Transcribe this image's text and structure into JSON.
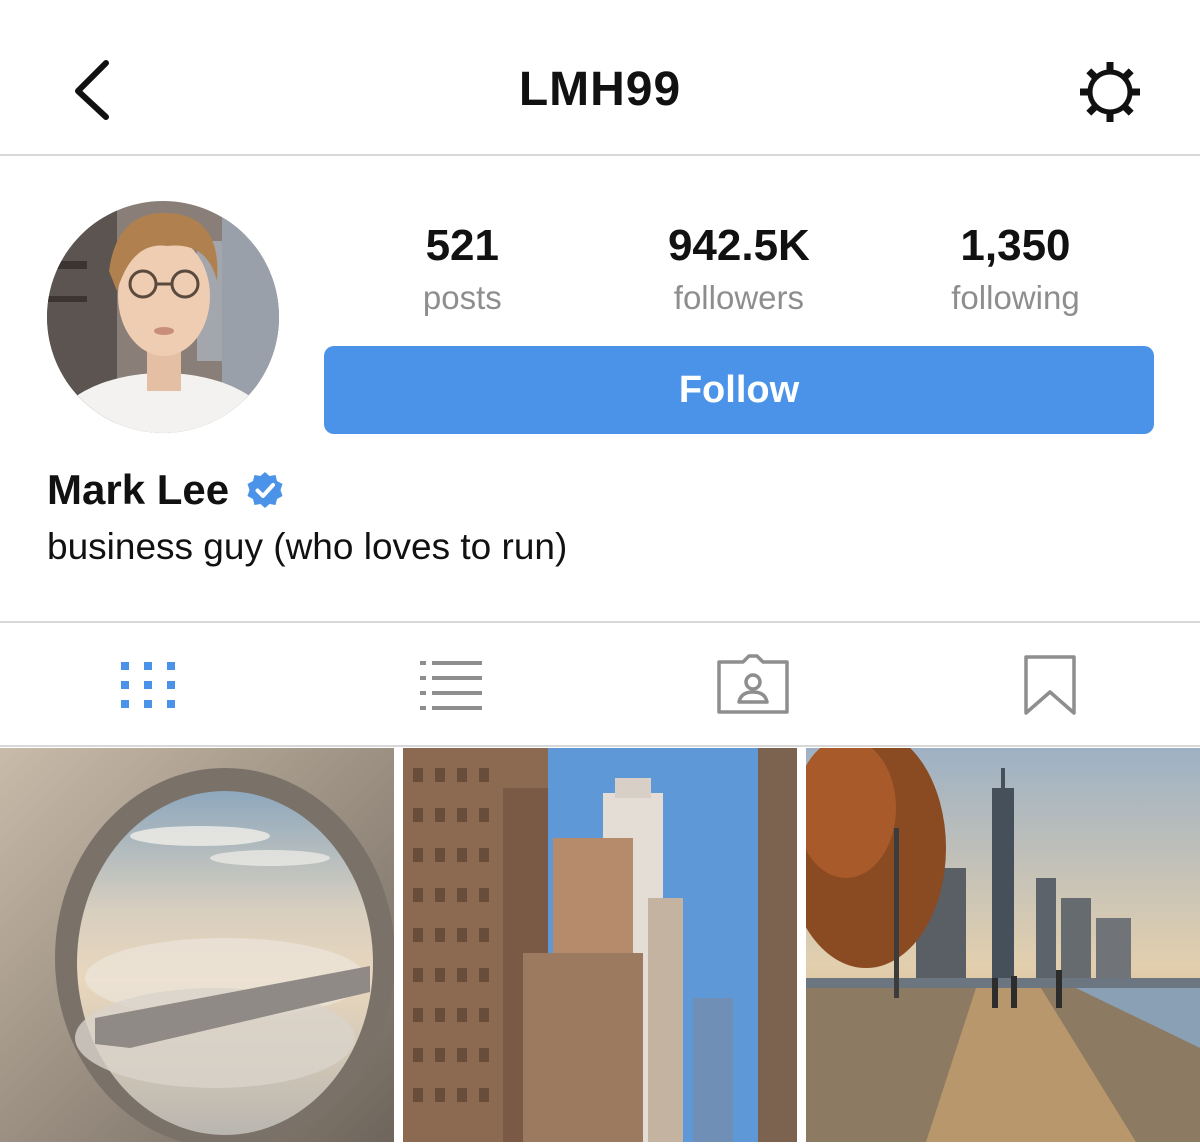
{
  "header": {
    "title": "LMH99",
    "back_icon": "chevron-left-icon",
    "settings_icon": "gear-icon"
  },
  "profile": {
    "display_name": "Mark Lee",
    "verified": true,
    "bio": "business guy (who loves to run)",
    "stats": [
      {
        "value": "521",
        "label": "posts"
      },
      {
        "value": "942.5K",
        "label": "followers"
      },
      {
        "value": "1,350",
        "label": "following"
      }
    ],
    "follow_label": "Follow"
  },
  "tabs": [
    {
      "icon": "grid-icon",
      "active": true
    },
    {
      "icon": "list-icon",
      "active": false
    },
    {
      "icon": "tagged-icon",
      "active": false
    },
    {
      "icon": "bookmark-icon",
      "active": false
    }
  ],
  "colors": {
    "accent": "#4b93e8",
    "inactive_icon": "#8e8e8e",
    "divider": "#d8d8d8",
    "verified_badge": "#4b93e8"
  }
}
